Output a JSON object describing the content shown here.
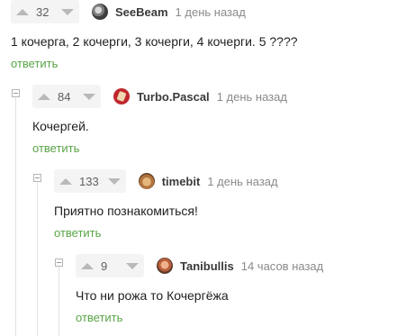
{
  "comments": [
    {
      "rating": "32",
      "username": "SeeBeam",
      "time": "1 день назад",
      "text": "1 кочерга, 2 кочерги, 3 кочерги, 4 кочерги. 5 ????",
      "reply": "ответить",
      "avatar_icon": "user-avatar-icon"
    },
    {
      "rating": "84",
      "username": "Turbo.Pascal",
      "time": "1 день назад",
      "text": "Кочергей.",
      "reply": "ответить",
      "avatar_icon": "user-avatar-icon"
    },
    {
      "rating": "133",
      "username": "timebit",
      "time": "1 день назад",
      "text": "Приятно познакомиться!",
      "reply": "ответить",
      "avatar_icon": "user-avatar-icon"
    },
    {
      "rating": "9",
      "username": "Tanibullis",
      "time": "14 часов назад",
      "text": "Что ни рожа то Кочергёжа",
      "reply": "ответить",
      "avatar_icon": "user-avatar-icon"
    }
  ],
  "colors": {
    "reply_link": "#58a447",
    "meta_text": "#8a8a8a",
    "rating_bg": "#f4f4f4",
    "thread_line": "#e2e2e2"
  }
}
